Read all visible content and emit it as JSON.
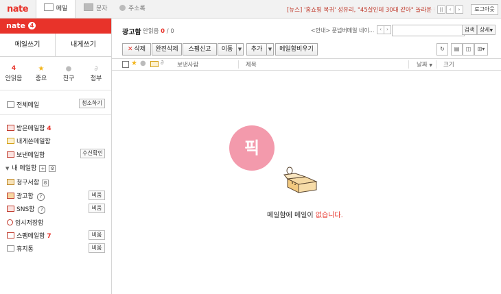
{
  "top": {
    "logo": "nate",
    "tabs": [
      {
        "label": "메일",
        "active": true
      },
      {
        "label": "문자",
        "active": false
      },
      {
        "label": "주소록",
        "active": false
      }
    ],
    "news": "[뉴스] '홈쇼핑 복귀' 성유리, \"45살인데 30대 같아\" 놀라운 동안미모",
    "logout": "로그아웃",
    "colors": {
      "accent": "#e8332a",
      "badge": "#f39aac"
    }
  },
  "sidebar": {
    "logo": "nate",
    "badge": "4",
    "compose": "메일쓰기",
    "to_me": "내게쓰기",
    "stats": [
      {
        "num": "4",
        "label": "안읽음",
        "icon": "envelope-icon"
      },
      {
        "num": "",
        "label": "중요",
        "icon": "star-icon"
      },
      {
        "num": "",
        "label": "친구",
        "icon": "person-icon"
      },
      {
        "num": "",
        "label": "첨부",
        "icon": "paperclip-icon"
      }
    ],
    "all_mail": "전체메일",
    "cleanup": "청소하기",
    "inbox": "받은메일함",
    "inbox_count": "4",
    "self_sent": "내게쓴메일함",
    "sent": "보낸메일함",
    "receipt": "수신확인",
    "my_folders": "내 메일함",
    "billing": "청구서함",
    "ads": "광고함",
    "sns": "SNS함",
    "drafts": "임시저장함",
    "spam": "스팸메일함",
    "spam_count": "7",
    "trash": "휴지통",
    "empty_label": "비움"
  },
  "main": {
    "title": "광고함",
    "unread_label": "안읽음",
    "unread_count": "0",
    "total": "/ 0",
    "notice": "<안내> 푼넘버메일 네이...",
    "search_btn": "검색",
    "detail_btn": "상세",
    "toolbar": {
      "delete": "삭제",
      "perm_delete": "완전삭제",
      "spam_report": "스팸신고",
      "move": "이동",
      "add": "추가",
      "empty_box": "메일함비우기"
    },
    "columns": {
      "from": "보낸사람",
      "subject": "제목",
      "date": "날짜",
      "size": "크기"
    },
    "empty_badge": "픽",
    "empty_msg_prefix": "메일함에 메일이 ",
    "empty_msg_red": "없습니다."
  }
}
